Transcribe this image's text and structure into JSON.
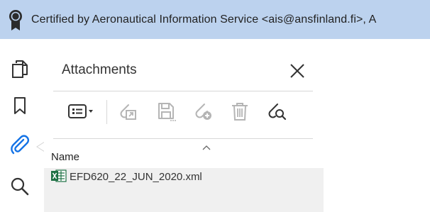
{
  "certification_bar": {
    "text": "Certified by Aeronautical Information Service <ais@ansfinland.fi>, A",
    "background_color": "#bcd2ee",
    "icon": "certificate-ribbon-icon"
  },
  "tool_rail": {
    "items": [
      {
        "name": "page-thumbnails",
        "icon": "pages-icon",
        "active": false
      },
      {
        "name": "bookmarks",
        "icon": "bookmark-icon",
        "active": false
      },
      {
        "name": "attachments",
        "icon": "paperclip-icon",
        "active": true
      },
      {
        "name": "search",
        "icon": "magnifier-icon",
        "active": false
      }
    ],
    "active_color": "#1473e6"
  },
  "attachments_panel": {
    "title": "Attachments",
    "close_icon": "close-icon",
    "toolbar": [
      {
        "name": "options-menu",
        "icon": "list-options-icon",
        "enabled": true
      },
      {
        "name": "open-attachment",
        "icon": "open-attachment-icon",
        "enabled": false
      },
      {
        "name": "save-attachment",
        "icon": "save-icon",
        "enabled": false
      },
      {
        "name": "add-attachment",
        "icon": "add-attachment-icon",
        "enabled": false
      },
      {
        "name": "delete-attachment",
        "icon": "trash-icon",
        "enabled": false
      },
      {
        "name": "search-attachments",
        "icon": "attachment-search-icon",
        "enabled": true
      }
    ],
    "columns": [
      {
        "label": "Name",
        "sort": "ascending"
      }
    ],
    "files": [
      {
        "name": "EFD620_22_JUN_2020.xml",
        "icon": "excel-file-icon"
      }
    ]
  }
}
